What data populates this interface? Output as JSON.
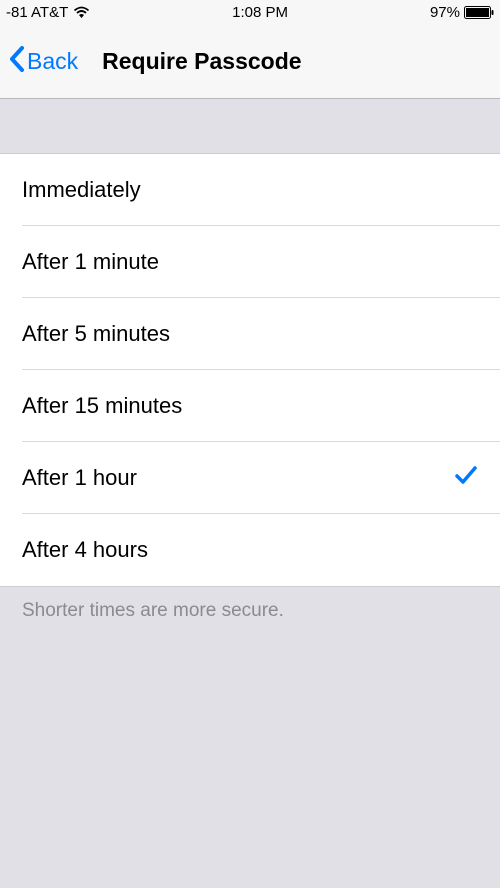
{
  "status": {
    "carrier": "-81 AT&T",
    "time": "1:08 PM",
    "battery_percent": "97%"
  },
  "nav": {
    "back_label": "Back",
    "title": "Require Passcode"
  },
  "options": [
    {
      "label": "Immediately",
      "selected": false
    },
    {
      "label": "After 1 minute",
      "selected": false
    },
    {
      "label": "After 5 minutes",
      "selected": false
    },
    {
      "label": "After 15 minutes",
      "selected": false
    },
    {
      "label": "After 1 hour",
      "selected": true
    },
    {
      "label": "After 4 hours",
      "selected": false
    }
  ],
  "footer": {
    "note": "Shorter times are more secure."
  },
  "colors": {
    "accent": "#0079ff"
  }
}
